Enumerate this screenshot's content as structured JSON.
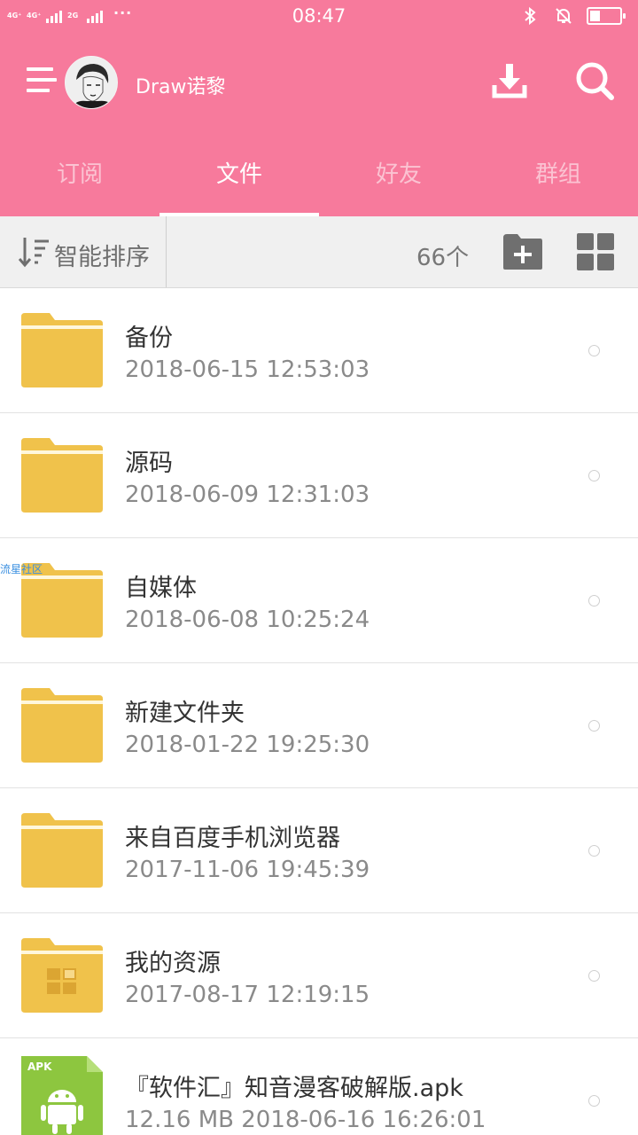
{
  "status_bar": {
    "network_1": "4G⁺",
    "network_2": "4G⁺",
    "network_3": "2G",
    "time": "08:47",
    "battery_level": 0.35
  },
  "header": {
    "username": "Draw诺黎",
    "background_color": "#f77a9c"
  },
  "tabs": [
    {
      "label": "订阅",
      "active": false
    },
    {
      "label": "文件",
      "active": true
    },
    {
      "label": "好友",
      "active": false
    },
    {
      "label": "群组",
      "active": false
    }
  ],
  "toolbar": {
    "sort_label": "智能排序",
    "count": "66个"
  },
  "files": [
    {
      "name": "备份",
      "meta": "2018-06-15 12:53:03",
      "type": "folder"
    },
    {
      "name": "源码",
      "meta": "2018-06-09 12:31:03",
      "type": "folder"
    },
    {
      "name": "自媒体",
      "meta": "2018-06-08 10:25:24",
      "type": "folder"
    },
    {
      "name": "新建文件夹",
      "meta": "2018-01-22 19:25:30",
      "type": "folder"
    },
    {
      "name": "来自百度手机浏览器",
      "meta": "2017-11-06 19:45:39",
      "type": "folder"
    },
    {
      "name": "我的资源",
      "meta": "2017-08-17 12:19:15",
      "type": "folder-apps"
    },
    {
      "name": "『软件汇』知音漫客破解版.apk",
      "meta": "12.16 MB 2018-06-16 16:26:01",
      "type": "apk",
      "badge": "APK"
    }
  ],
  "watermark": "流星社区",
  "colors": {
    "folder": "#f0c24b",
    "apk": "#8dc63f"
  }
}
